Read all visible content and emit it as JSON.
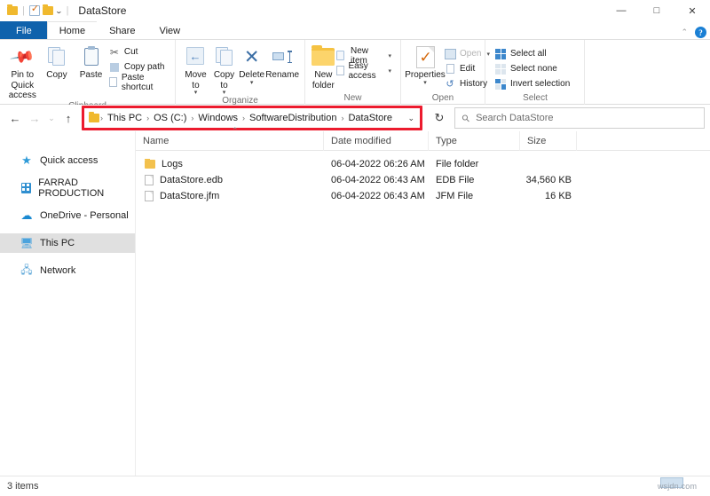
{
  "window": {
    "title": "DataStore",
    "quick_access": [
      "folder-icon",
      "properties-icon",
      "new-folder-icon",
      "customize-caret-icon"
    ],
    "controls": {
      "minimize": "—",
      "maximize": "□",
      "close": "✕"
    }
  },
  "tabs": [
    {
      "label": "File",
      "active_style": "file"
    },
    {
      "label": "Home",
      "active_style": "active"
    },
    {
      "label": "Share",
      "active_style": "plain"
    },
    {
      "label": "View",
      "active_style": "plain"
    }
  ],
  "tab_right": {
    "collapse": "⌃",
    "help": "?"
  },
  "ribbon": {
    "groups": [
      {
        "label": "Clipboard",
        "big": [
          {
            "label": "Pin to Quick access",
            "icon": "pin-icon"
          },
          {
            "label": "Copy",
            "icon": "copy-icon"
          },
          {
            "label": "Paste",
            "icon": "paste-icon"
          }
        ],
        "small": [
          {
            "label": "Cut",
            "icon": "scissors-icon",
            "dim": false
          },
          {
            "label": "Copy path",
            "icon": "copy-path-icon",
            "dim": false
          },
          {
            "label": "Paste shortcut",
            "icon": "paste-shortcut-icon",
            "dim": false
          }
        ]
      },
      {
        "label": "Organize",
        "big": [
          {
            "label": "Move to",
            "icon": "move-to-icon",
            "caret": true
          },
          {
            "label": "Copy to",
            "icon": "copy-to-icon",
            "caret": true
          },
          {
            "label": "Delete",
            "icon": "delete-x-icon",
            "caret": true
          },
          {
            "label": "Rename",
            "icon": "rename-icon"
          }
        ],
        "small": []
      },
      {
        "label": "New",
        "big": [
          {
            "label": "New folder",
            "icon": "new-folder-icon"
          }
        ],
        "small": [
          {
            "label": "New item",
            "icon": "new-item-icon",
            "caret": true
          },
          {
            "label": "Easy access",
            "icon": "easy-access-icon",
            "caret": true
          }
        ]
      },
      {
        "label": "Open",
        "big": [
          {
            "label": "Properties",
            "icon": "properties-icon",
            "caret": true
          }
        ],
        "small": [
          {
            "label": "Open",
            "icon": "open-icon",
            "dim": true,
            "caret": true
          },
          {
            "label": "Edit",
            "icon": "edit-icon",
            "dim": false
          },
          {
            "label": "History",
            "icon": "history-icon",
            "dim": false
          }
        ]
      },
      {
        "label": "Select",
        "big": [],
        "small": [
          {
            "label": "Select all",
            "icon": "select-all-icon"
          },
          {
            "label": "Select none",
            "icon": "select-none-icon"
          },
          {
            "label": "Invert selection",
            "icon": "invert-selection-icon"
          }
        ]
      }
    ]
  },
  "nav": {
    "back": "←",
    "forward": "→",
    "recent": "⌄",
    "up": "↑",
    "refresh": "↻"
  },
  "address": {
    "folder_icon": "folder-icon",
    "crumbs": [
      "This PC",
      "OS (C:)",
      "Windows",
      "SoftwareDistribution",
      "DataStore"
    ],
    "separator": "›",
    "dropdown": "⌄",
    "highlight_color": "#ec1b2e"
  },
  "search": {
    "placeholder": "Search DataStore",
    "icon": "search-icon"
  },
  "sidebar": {
    "items": [
      {
        "label": "Quick access",
        "icon": "star-pin-icon",
        "selected": false
      },
      {
        "label": "FARRAD PRODUCTION",
        "icon": "building-icon",
        "selected": false
      },
      {
        "label": "OneDrive - Personal",
        "icon": "cloud-icon",
        "selected": false
      },
      {
        "label": "This PC",
        "icon": "pc-icon",
        "selected": true
      },
      {
        "label": "Network",
        "icon": "network-icon",
        "selected": false
      }
    ]
  },
  "file_list": {
    "columns": [
      "Name",
      "Date modified",
      "Type",
      "Size"
    ],
    "sort_indicator": "⌃",
    "rows": [
      {
        "name": "Logs",
        "date": "06-04-2022 06:26 AM",
        "type": "File folder",
        "size": "",
        "icon": "folder-icon"
      },
      {
        "name": "DataStore.edb",
        "date": "06-04-2022 06:43 AM",
        "type": "EDB File",
        "size": "34,560 KB",
        "icon": "file-icon"
      },
      {
        "name": "DataStore.jfm",
        "date": "06-04-2022 06:43 AM",
        "type": "JFM File",
        "size": "16 KB",
        "icon": "file-icon"
      }
    ]
  },
  "status": {
    "item_count": "3 items"
  },
  "watermark": {
    "text": "wsjdn.com"
  }
}
